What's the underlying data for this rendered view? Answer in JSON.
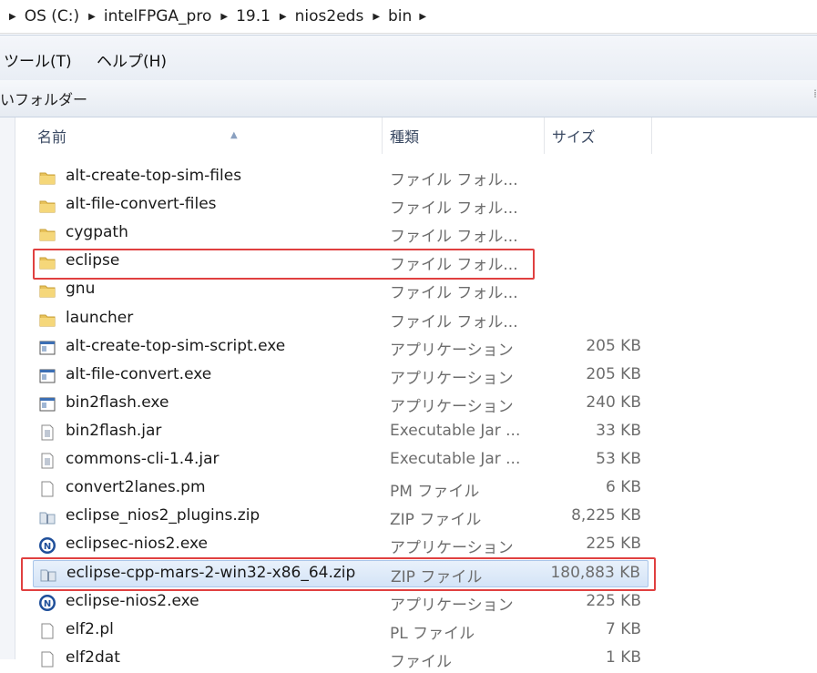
{
  "breadcrumb": [
    "OS (C:)",
    "intelFPGA_pro",
    "19.1",
    "nios2eds",
    "bin"
  ],
  "menu": [
    "ツール(T)",
    "ヘルプ(H)"
  ],
  "toolbar": {
    "new_folder_label": "いフォルダー"
  },
  "columns": {
    "name": "名前",
    "type": "種類",
    "size": "サイズ"
  },
  "rows": [
    {
      "name": "alt-create-top-sim-files",
      "type": "ファイル フォル...",
      "size": "",
      "icon": "folder-icon"
    },
    {
      "name": "alt-file-convert-files",
      "type": "ファイル フォル...",
      "size": "",
      "icon": "folder-icon"
    },
    {
      "name": "cygpath",
      "type": "ファイル フォル...",
      "size": "",
      "icon": "folder-icon"
    },
    {
      "name": "eclipse",
      "type": "ファイル フォル...",
      "size": "",
      "icon": "folder-icon"
    },
    {
      "name": "gnu",
      "type": "ファイル フォル...",
      "size": "",
      "icon": "folder-icon"
    },
    {
      "name": "launcher",
      "type": "ファイル フォル...",
      "size": "",
      "icon": "folder-icon"
    },
    {
      "name": "alt-create-top-sim-script.exe",
      "type": "アプリケーション",
      "size": "205 KB",
      "icon": "exe-icon"
    },
    {
      "name": "alt-file-convert.exe",
      "type": "アプリケーション",
      "size": "205 KB",
      "icon": "exe-icon"
    },
    {
      "name": "bin2flash.exe",
      "type": "アプリケーション",
      "size": "240 KB",
      "icon": "exe-icon"
    },
    {
      "name": "bin2flash.jar",
      "type": "Executable Jar ...",
      "size": "33 KB",
      "icon": "jar-icon"
    },
    {
      "name": "commons-cli-1.4.jar",
      "type": "Executable Jar ...",
      "size": "53 KB",
      "icon": "jar-icon"
    },
    {
      "name": "convert2lanes.pm",
      "type": "PM ファイル",
      "size": "6 KB",
      "icon": "file-icon"
    },
    {
      "name": "eclipse_nios2_plugins.zip",
      "type": "ZIP ファイル",
      "size": "8,225 KB",
      "icon": "zip-icon"
    },
    {
      "name": "eclipsec-nios2.exe",
      "type": "アプリケーション",
      "size": "225 KB",
      "icon": "nios-icon"
    },
    {
      "name": "eclipse-cpp-mars-2-win32-x86_64.zip",
      "type": "ZIP ファイル",
      "size": "180,883 KB",
      "icon": "zip-icon",
      "selected": true
    },
    {
      "name": "eclipse-nios2.exe",
      "type": "アプリケーション",
      "size": "225 KB",
      "icon": "nios-icon"
    },
    {
      "name": "elf2.pl",
      "type": "PL ファイル",
      "size": "7 KB",
      "icon": "file-icon"
    },
    {
      "name": "elf2dat",
      "type": "ファイル",
      "size": "1 KB",
      "icon": "file-icon"
    }
  ],
  "colors": {
    "highlight_box": "#e04040",
    "selection": "#d4e4f7"
  }
}
